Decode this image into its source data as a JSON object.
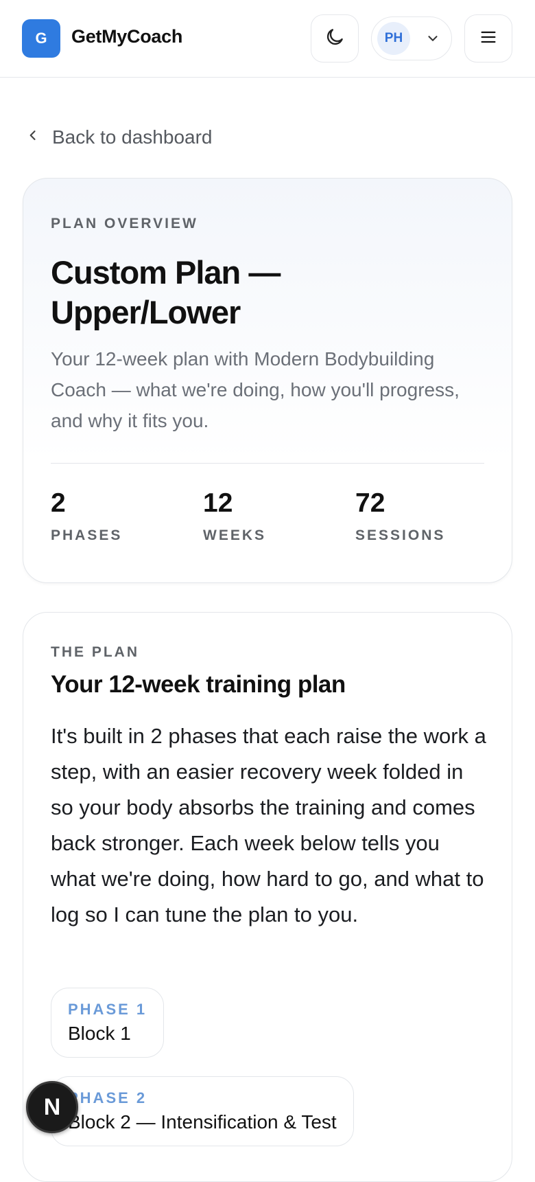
{
  "header": {
    "logo_letter": "G",
    "brand": "GetMyCoach",
    "theme_icon": "moon-icon",
    "user_initials": "PH",
    "user_chevron_icon": "chevron-down-icon",
    "menu_icon": "hamburger-menu-icon"
  },
  "nav": {
    "back_label": "Back to dashboard",
    "back_icon": "chevron-left-icon"
  },
  "overview": {
    "eyebrow": "PLAN OVERVIEW",
    "title": "Custom Plan — Upper/Lower",
    "description": "Your 12-week plan with Modern Bodybuilding Coach — what we're doing, how you'll progress, and why it fits you.",
    "stats": [
      {
        "value": "2",
        "label": "PHASES"
      },
      {
        "value": "12",
        "label": "WEEKS"
      },
      {
        "value": "72",
        "label": "SESSIONS"
      }
    ]
  },
  "plan": {
    "eyebrow": "THE PLAN",
    "title": "Your 12-week training plan",
    "body": "It's built in 2 phases that each raise the work a step, with an easier recovery week folded in so your body absorbs the training and comes back stronger. Each week below tells you what we're doing, how hard to go, and what to log so I can tune the plan to you.",
    "phases": [
      {
        "label": "PHASE 1",
        "name": "Block 1"
      },
      {
        "label": "PHASE 2",
        "name": "Block 2 — Intensification & Test"
      }
    ]
  },
  "dev_badge": {
    "letter": "N"
  },
  "colors": {
    "accent": "#2f7be0",
    "phase_label": "#6a9ad8",
    "muted_text": "#6b7078",
    "border": "#e3e6ea"
  }
}
